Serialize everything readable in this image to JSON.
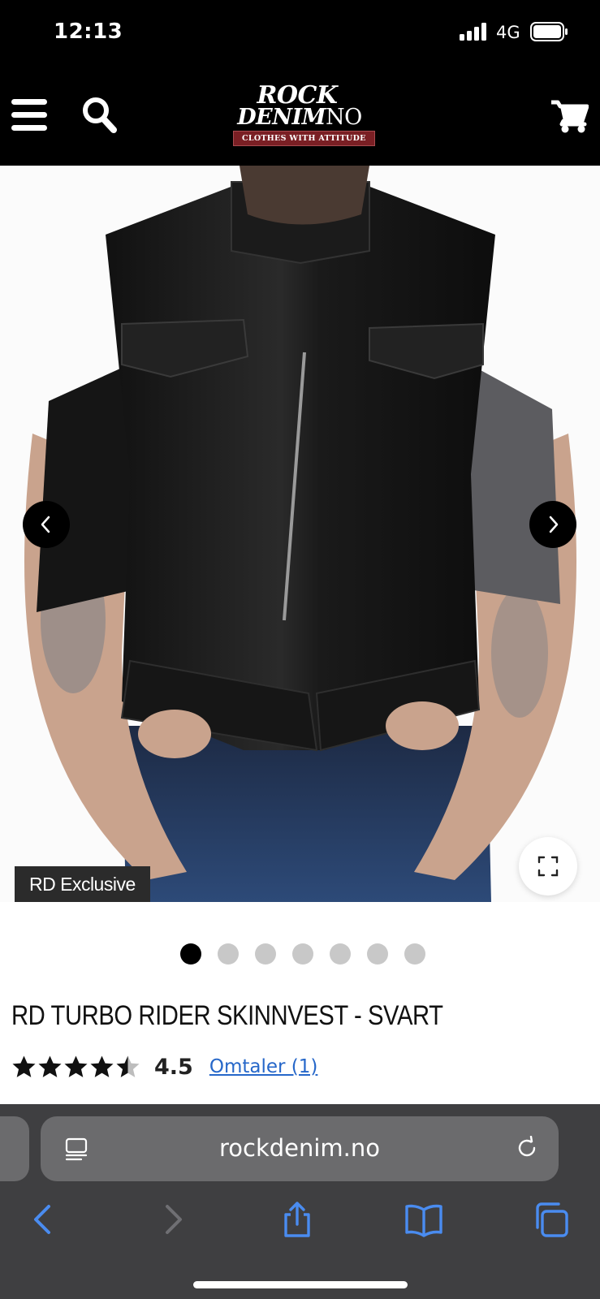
{
  "status_bar": {
    "time": "12:13",
    "network": "4G"
  },
  "header": {
    "logo": {
      "line1": "ROCK",
      "line2": "DENIM",
      "suffix": "NO",
      "tagline": "CLOTHES WITH ATTITUDE"
    },
    "icons": [
      "menu-icon",
      "search-icon",
      "cart-icon"
    ]
  },
  "product": {
    "badge": "RD Exclusive",
    "image_count": 7,
    "active_image_index": 0,
    "title": "RD TURBO RIDER SKINNVEST - SVART",
    "rating": {
      "stars_max": 5,
      "value_label": "4.5",
      "value": 4.5
    },
    "reviews_link": "Omtaler (1)"
  },
  "browser": {
    "url": "rockdenim.no",
    "accent_color": "#4a8cf0"
  }
}
